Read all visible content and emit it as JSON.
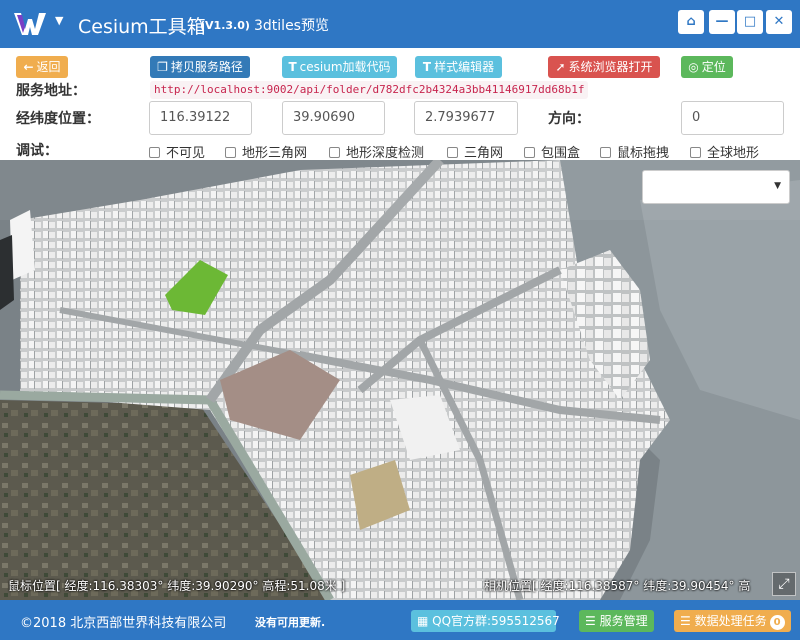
{
  "titlebar": {
    "title": "Cesium工具箱",
    "version": "(V1.3.0)",
    "subtitle": "3dtiles预览",
    "bg_color": "#2f77c4",
    "buttons": [
      {
        "icon": "home-icon",
        "glyph": "⌂"
      },
      {
        "icon": "minimize-icon",
        "glyph": "—"
      },
      {
        "icon": "maximize-icon",
        "glyph": "□"
      },
      {
        "icon": "close-icon",
        "glyph": "✕"
      }
    ]
  },
  "toolbar": {
    "back_label": "返回",
    "copy_label": "拷贝服务路径",
    "code_label": "cesium加载代码",
    "style_label": "样式编辑器",
    "browser_label": "系统浏览器打开",
    "locate_label": "定位"
  },
  "service": {
    "label": "服务地址：",
    "url": "http://localhost:9002/api/folder/d782dfc2b4324a3bb41146917dd68b1f"
  },
  "position": {
    "label": "经纬度位置：",
    "lon": "116.39122",
    "lat": "39.90690",
    "height": "2.7939677",
    "heading_label": "方向：",
    "heading": "0"
  },
  "debug": {
    "label": "调试：",
    "options": [
      "不可见",
      "地形三角网",
      "地形深度检测",
      "三角网",
      "包围盒",
      "鼠标拖拽",
      "全球地形"
    ]
  },
  "map": {
    "layer_select_value": "",
    "mouse_position": "鼠标位置[ 经度:116.38303° 纬度:39.90290° 高程:51.08米 ]",
    "camera_position": "相机位置[ 经度:116.38587° 纬度:39.90454° 高"
  },
  "footer": {
    "copyright": "©2018 北京西部世界科技有限公司",
    "update_status": "没有可用更新.",
    "qq_label": "QQ官方群:595512567",
    "services_label": "服务管理",
    "tasks_label": "数据处理任务",
    "tasks_count": "0"
  }
}
